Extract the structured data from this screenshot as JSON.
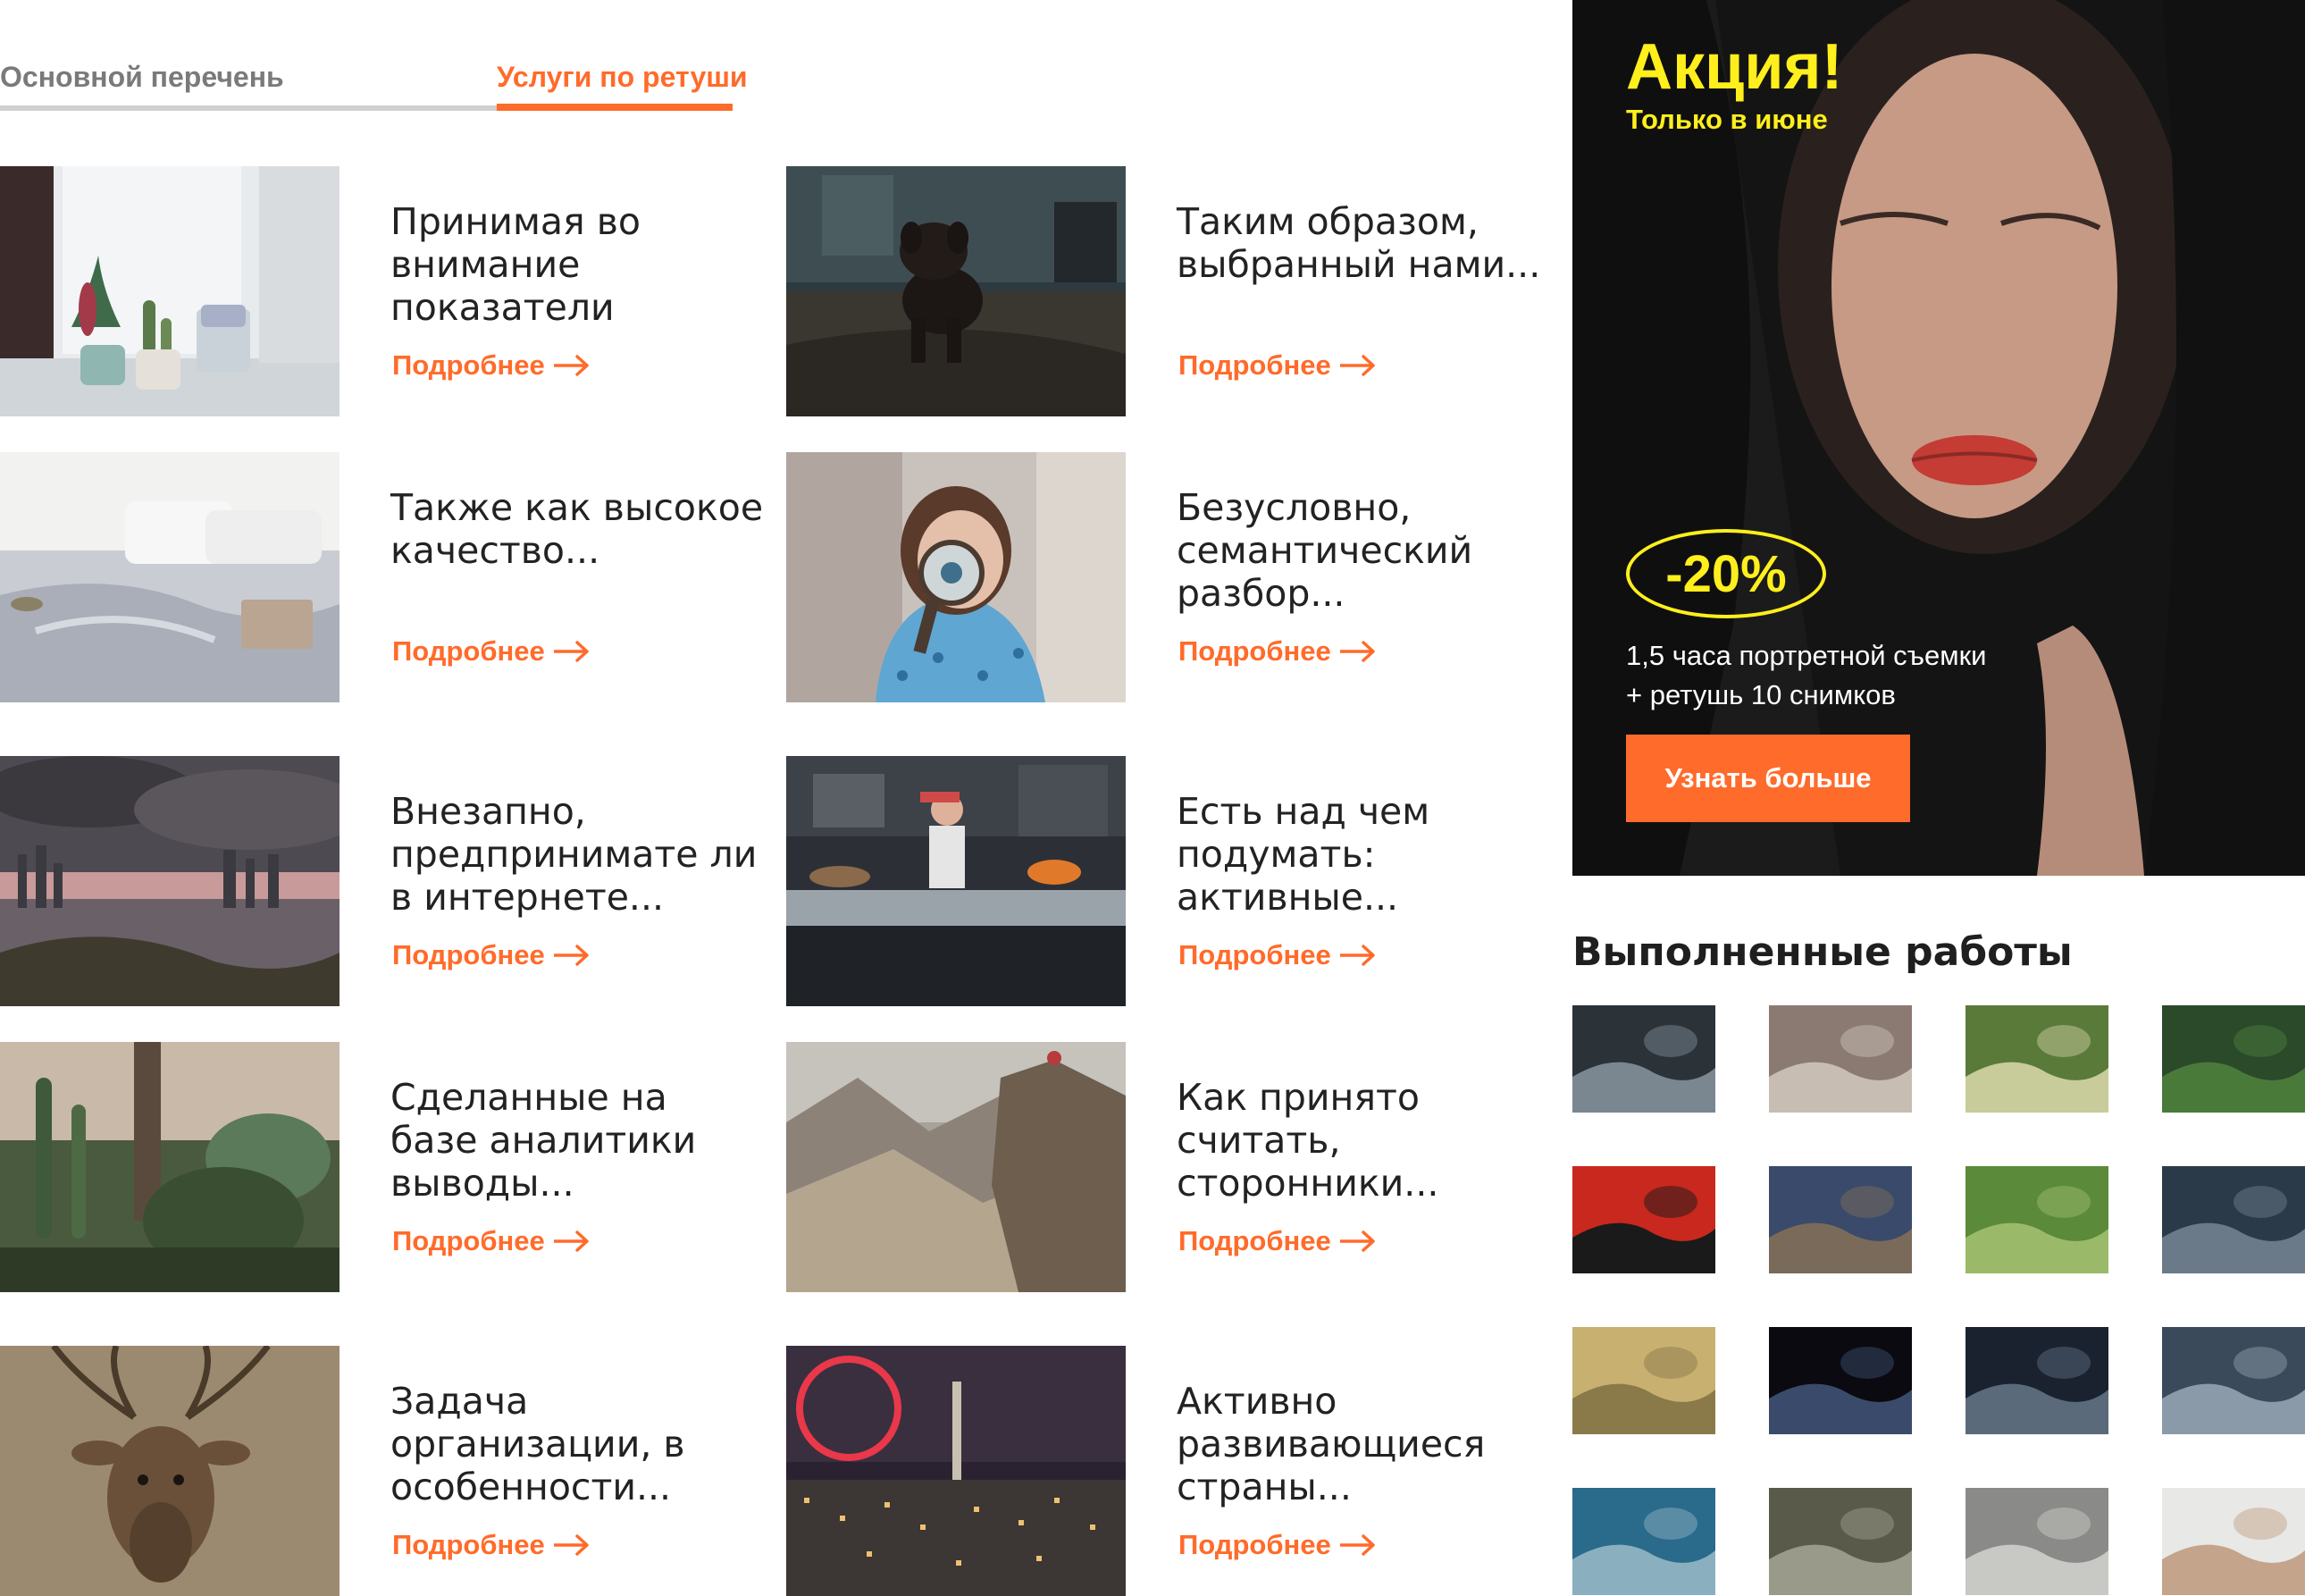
{
  "tabs": [
    {
      "label": "Основной перечень"
    },
    {
      "label": "Услуги по ретуши"
    }
  ],
  "cards": [
    {
      "title": "Принимая во внимание показатели",
      "image": "cactus-windowsill-photo"
    },
    {
      "title": "Таким образом, выбранный нами...",
      "image": "puppy-photo"
    },
    {
      "title": "Также как высокое качество...",
      "image": "bedroom-laptop-photo"
    },
    {
      "title": "Безусловно, семантический разбор...",
      "image": "child-magnifier-photo"
    },
    {
      "title": "Внезапно, предпринимате ли в интернете...",
      "image": "city-harbor-sunset-photo"
    },
    {
      "title": "Есть над чем подумать: активные...",
      "image": "kitchen-chef-photo"
    },
    {
      "title": "Сделанные на базе аналитики выводы...",
      "image": "cactus-garden-photo"
    },
    {
      "title": "Как принято считать, сторонники...",
      "image": "mountain-cliff-photo"
    },
    {
      "title": "Задача организации, в особенности...",
      "image": "deer-photo"
    },
    {
      "title": "Активно развивающиеся страны...",
      "image": "london-night-photo"
    }
  ],
  "card_link_label": "Подробнее",
  "promo": {
    "title": "Акция!",
    "subtitle": "Только в июне",
    "discount": "-20%",
    "line1": "1,5 часа портретной съемки",
    "line2": "+ ретушь 10 снимков",
    "button": "Узнать больше"
  },
  "works": {
    "title": "Выполненные работы",
    "thumbs": [
      "window-rain",
      "door-notice",
      "palm-forest",
      "green-leaves",
      "stained-glass",
      "elephant",
      "garden-woman",
      "aerial-city",
      "wheat-field",
      "planet-dark",
      "night-street",
      "bridge-river",
      "coastline",
      "city-traffic",
      "car-highway",
      "camera-desk"
    ]
  },
  "colors": {
    "accent": "#ff6b2b",
    "promo_yellow": "#ffef1c",
    "text": "#1f1f1f",
    "muted": "#7a7a7a"
  }
}
